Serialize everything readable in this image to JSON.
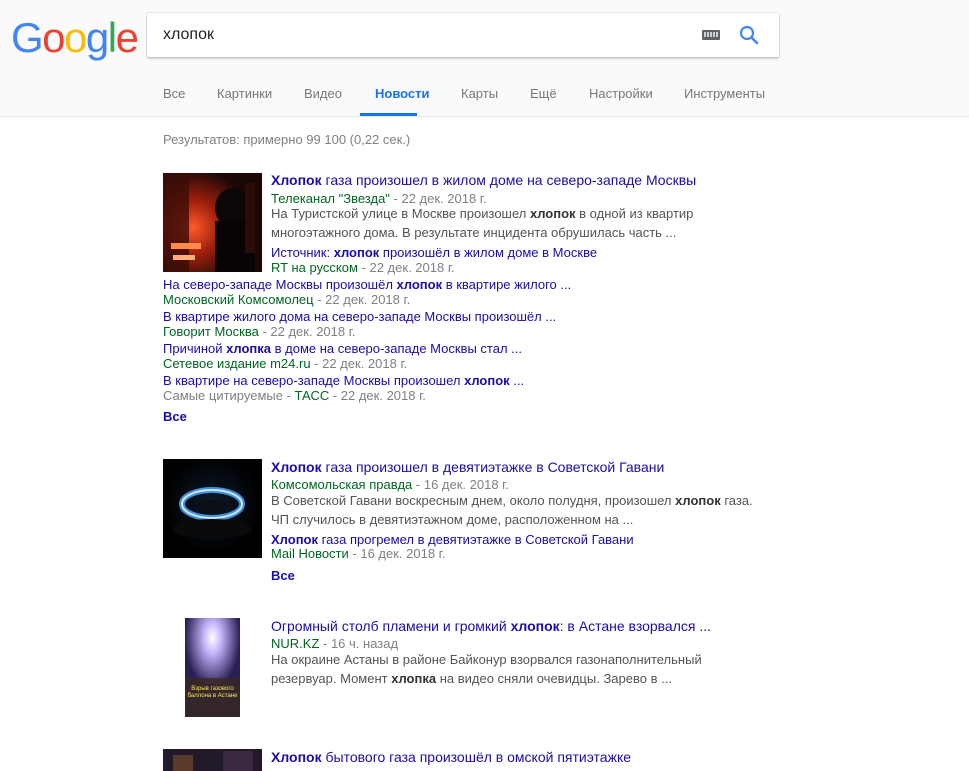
{
  "logo_letters": [
    {
      "ch": "G",
      "color": "#4285f4"
    },
    {
      "ch": "o",
      "color": "#ea4335"
    },
    {
      "ch": "o",
      "color": "#fbbc05"
    },
    {
      "ch": "g",
      "color": "#4285f4"
    },
    {
      "ch": "l",
      "color": "#34a853"
    },
    {
      "ch": "e",
      "color": "#ea4335"
    }
  ],
  "search": {
    "value": "хлопок"
  },
  "tabs": [
    "Все",
    "Картинки",
    "Видео",
    "Новости",
    "Карты",
    "Ещё",
    "Настройки",
    "Инструменты"
  ],
  "active_tab": "Новости",
  "stats": "Результатов: примерно 99 100 (0,22 сек.)",
  "results": [
    {
      "title_bold": "Хлопок",
      "title_rest": " газа произошел в жилом доме на северо-западе Москвы",
      "source": "Телеканал \"Звезда\"",
      "date": " - 22 дек. 2018 г.",
      "snippet1_a": "На Туристской улице в Москве произошел ",
      "snippet1_b": "хлопок",
      "snippet1_c": " в одной из квартир",
      "snippet2": "многоэтажного дома. В результате инцидента обрушилась часть ...",
      "sub": [
        {
          "pre": "Источник: ",
          "bold": "хлопок",
          "post": " произошёл в жилом доме в Москве",
          "source": "RT на русском",
          "date": " - 22 дек. 2018 г."
        },
        {
          "pre": "На северо-западе Москвы произошёл ",
          "bold": "хлопок",
          "post": " в квартире жилого ...",
          "source": "Московский Комсомолец",
          "date": " - 22 дек. 2018 г."
        },
        {
          "pre": "В квартире жилого дома на северо-западе Москвы произошёл ...",
          "bold": "",
          "post": "",
          "source": "Говорит Москва",
          "date": " - 22 дек. 2018 г."
        },
        {
          "pre": "Причиной ",
          "bold": "хлопка",
          "post": " в доме на северо-западе Москвы стал ...",
          "source": "Сетевое издание m24.ru",
          "date": " - 22 дек. 2018 г."
        },
        {
          "pre": "В квартире на северо-западе Москвы произошел ",
          "bold": "хлопок",
          "post": " ...",
          "source_grey": "Самые цитируемые - ",
          "source": "ТАСС",
          "date": " - 22 дек. 2018 г."
        }
      ],
      "all_label": "Все"
    },
    {
      "title_bold": "Хлопок",
      "title_rest": " газа произошел в девятиэтажке в Советской Гавани",
      "source": "Комсомольская правда",
      "date": " - 16 дек. 2018 г.",
      "snippet1_a": "В Советской Гавани воскресным днем, около полудня, произошел ",
      "snippet1_b": "хлопок",
      "snippet1_c": " газа.",
      "snippet2": "ЧП случилось в девятиэтажном доме, расположенном на ...",
      "sub": [
        {
          "pre": "",
          "bold": "Хлопок",
          "post": " газа прогремел в девятиэтажке в Советской Гавани",
          "source": "Mail Новости",
          "date": " - 16 дек. 2018 г."
        }
      ],
      "all_label": "Все"
    },
    {
      "title_pre": "Огромный столб пламени и громкий ",
      "title_bold": "хлопок",
      "title_rest": ": в Астане взорвался ...",
      "source": "NUR.KZ",
      "date": " - 16 ч. назад",
      "snippet1_a": "На окраине Астаны в районе Байконур взорвался газонаполнительный",
      "snippet2_a": "резервуар. Момент ",
      "snippet2_b": "хлопка",
      "snippet2_c": " на видео сняли очевидцы. Зарево в ...",
      "thumb_text": "Взрыв газового баллона в Астане"
    },
    {
      "title_bold": "Хлопок",
      "title_rest": " бытового газа произошёл в омской пятиэтажке"
    }
  ]
}
